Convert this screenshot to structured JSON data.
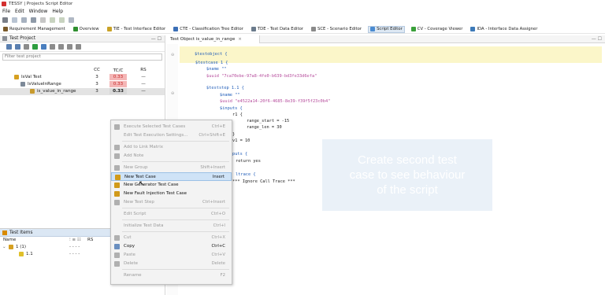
{
  "window": {
    "title": "TESSY | Projects Script Editor"
  },
  "menu": [
    "File",
    "Edit",
    "Window",
    "Help"
  ],
  "perspectives": [
    {
      "label": "Requirement Management",
      "color": "#7a5a2a",
      "active": false
    },
    {
      "label": "Overview",
      "color": "#2f8f2f",
      "active": false
    },
    {
      "label": "TIE - Test Interface Editor",
      "color": "#c9a227",
      "active": false
    },
    {
      "label": "CTE - Classification Tree Editor",
      "color": "#3b6fb6",
      "active": false
    },
    {
      "label": "TDE - Test Data Editor",
      "color": "#6b7b8c",
      "active": false
    },
    {
      "label": "SCE - Scenario Editor",
      "color": "#8a8a8a",
      "active": false
    },
    {
      "label": "Script Editor",
      "color": "#4a8bd1",
      "active": true
    },
    {
      "label": "CV - Coverage Viewer",
      "color": "#3aa03a",
      "active": false
    },
    {
      "label": "IDA - Interface Data Assigner",
      "color": "#3d7ab8",
      "active": false
    }
  ],
  "test_project": {
    "title": "Test Project",
    "filter_placeholder": "Filter test project",
    "columns": {
      "cc": "CC",
      "tc": "TC/C",
      "rs": "RS"
    },
    "rows": [
      {
        "name": "IsVal Test",
        "cc": "3",
        "tc": "0.33",
        "rs": "—",
        "style": "red",
        "indent": 18
      },
      {
        "name": "IsValueInRange",
        "cc": "3",
        "tc": "0.33",
        "rs": "—",
        "style": "red",
        "indent": 26
      },
      {
        "name": "is_value_in_range",
        "cc": "3",
        "tc": "0.33",
        "rs": "—",
        "style": "gray",
        "indent": 38
      }
    ]
  },
  "test_items": {
    "title": "Test Items",
    "name_header": "Name",
    "rs_header": "RS",
    "rows": [
      {
        "name": "1 (1)",
        "indent": 10
      },
      {
        "name": "1.1",
        "indent": 24
      }
    ]
  },
  "editor": {
    "tab_label": "Test Object is_value_in_range",
    "tab_close": "×",
    "code": {
      "testobject": "$testobject {",
      "testcase": "$testcase 1 {",
      "name1": "$name \"\"",
      "uuid1": "$uuid \"7ca70ebe-97a8-4fe0-b639-bd3fe33d6efa\"",
      "teststep": "$teststep 1.1 {",
      "name2": "$name \"\"",
      "uuid2": "$uuid \"e4522a14-20f6-4685-8e39-f39f5f23c0b4\"",
      "inputs": "$inputs {",
      "r1": "r1 {",
      "range_start": "range_start = -15",
      "range_len": "range_len = 30",
      "close1": "}",
      "v1": "v1 = 10",
      "outputs": "puts {",
      "return": "return yes",
      "calltrace": "ltrace {",
      "ignore": "*** Ignore Call Trace ***"
    }
  },
  "overlay_text": "Create second test\ncase to see behaviour\nof the script",
  "context_menu": [
    {
      "label": "Execute Selected Test Cases",
      "shortcut": "Ctrl+E",
      "state": "dis",
      "icon": "#b0b0b0"
    },
    {
      "label": "Edit Test Execution Settings...",
      "shortcut": "Ctrl+Shift+E",
      "state": "dis",
      "icon": ""
    },
    {
      "label": "Add to Link Matrix",
      "shortcut": "",
      "state": "dis",
      "icon": "#b0b0b0"
    },
    {
      "label": "Add Note",
      "shortcut": "",
      "state": "dis",
      "icon": "#b0b0b0"
    },
    {
      "label": "New Group",
      "shortcut": "Shift+Insert",
      "state": "dis",
      "icon": "#b0b0b0"
    },
    {
      "label": "New Test Case",
      "shortcut": "Insert",
      "state": "en",
      "icon": "#d19a1a",
      "selected": true
    },
    {
      "label": "New Generator Test Case",
      "shortcut": "",
      "state": "en",
      "icon": "#d19a1a"
    },
    {
      "label": "New Fault Injection Test Case",
      "shortcut": "",
      "state": "en",
      "icon": "#d19a1a"
    },
    {
      "label": "New Test Step",
      "shortcut": "Ctrl+Insert",
      "state": "dis",
      "icon": "#b0b0b0"
    },
    {
      "label": "Edit Script",
      "shortcut": "Ctrl+O",
      "state": "dis",
      "icon": ""
    },
    {
      "label": "Initialize Test Data",
      "shortcut": "Ctrl+I",
      "state": "dis",
      "icon": ""
    },
    {
      "label": "Cut",
      "shortcut": "Ctrl+X",
      "state": "dis",
      "icon": "#b0b0b0"
    },
    {
      "label": "Copy",
      "shortcut": "Ctrl+C",
      "state": "en",
      "icon": "#6a8fc0"
    },
    {
      "label": "Paste",
      "shortcut": "Ctrl+V",
      "state": "dis",
      "icon": "#b0b0b0"
    },
    {
      "label": "Delete",
      "shortcut": "Delete",
      "state": "dis",
      "icon": "#b0b0b0"
    },
    {
      "label": "Rename",
      "shortcut": "F2",
      "state": "dis",
      "icon": ""
    }
  ]
}
